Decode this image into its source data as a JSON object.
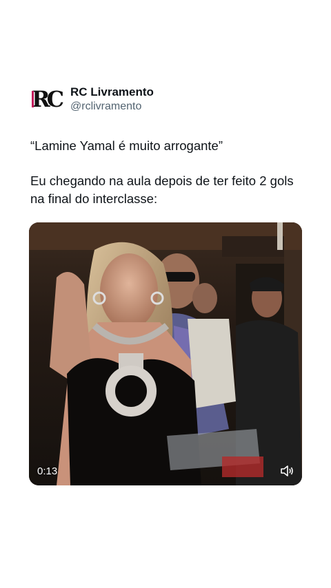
{
  "author": {
    "name": "RC Livramento",
    "handle": "@rclivramento",
    "avatar_letters": "RC"
  },
  "tweet": {
    "quote": "“Lamine Yamal é muito arrogante”",
    "line1": "Eu chegando na aula depois de ter feito 2 gols",
    "line2": "na final do interclasse:"
  },
  "video": {
    "time": "0:13",
    "sound_icon": "speaker-icon"
  },
  "colors": {
    "text": "#0f1419",
    "secondary": "#536471",
    "accent": "#c2185b"
  }
}
